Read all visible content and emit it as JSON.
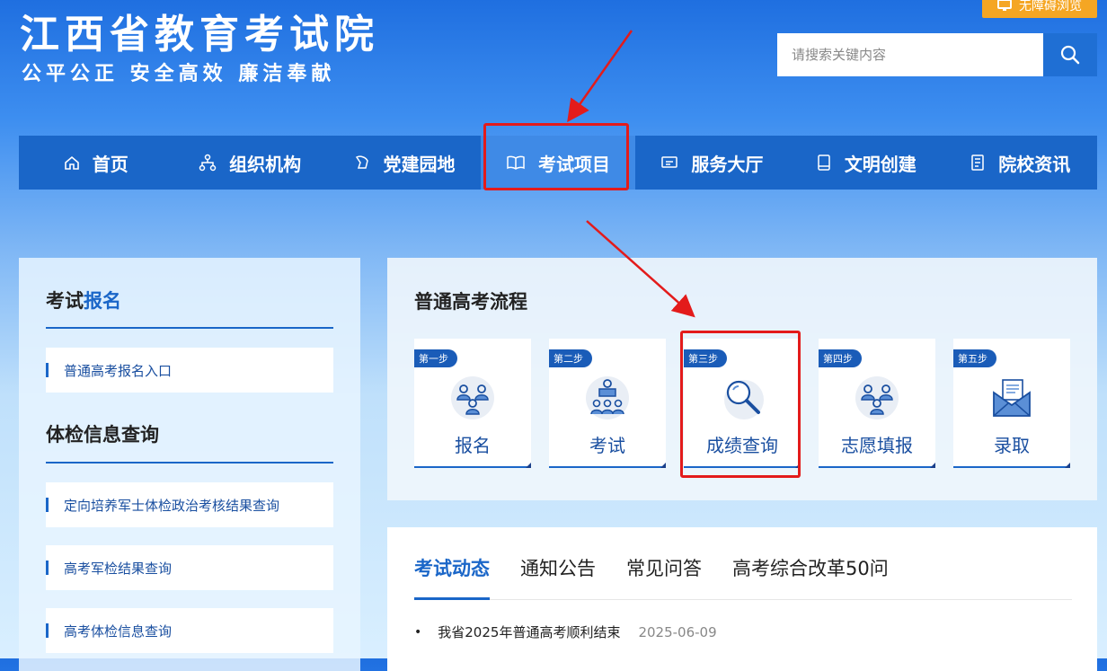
{
  "header": {
    "title": "江西省教育考试院",
    "slogan": "公平公正  安全高效  廉洁奉献",
    "accessibility_label": "无障碍浏览",
    "search": {
      "placeholder": "请搜索关键内容",
      "value": ""
    }
  },
  "nav": {
    "items": [
      {
        "label": "首页",
        "icon": "home-icon"
      },
      {
        "label": "组织机构",
        "icon": "org-chart-icon"
      },
      {
        "label": "党建园地",
        "icon": "party-icon"
      },
      {
        "label": "考试项目",
        "icon": "book-icon",
        "active": true
      },
      {
        "label": "服务大厅",
        "icon": "service-icon"
      },
      {
        "label": "文明创建",
        "icon": "notebook-icon"
      },
      {
        "label": "院校资讯",
        "icon": "document-icon"
      }
    ]
  },
  "left_panel": {
    "section1": {
      "title_prefix": "考试",
      "title_highlight": "报名",
      "links": [
        "普通高考报名入口"
      ]
    },
    "section2": {
      "title": "体检信息查询",
      "links": [
        "定向培养军士体检政治考核结果查询",
        "高考军检结果查询",
        "高考体检信息查询"
      ]
    }
  },
  "process": {
    "title": "普通高考流程",
    "steps": [
      {
        "badge": "第一步",
        "label": "报名",
        "icon": "people-icon"
      },
      {
        "badge": "第二步",
        "label": "考试",
        "icon": "exam-icon"
      },
      {
        "badge": "第三步",
        "label": "成绩查询",
        "icon": "magnifier-icon"
      },
      {
        "badge": "第四步",
        "label": "志愿填报",
        "icon": "people-icon"
      },
      {
        "badge": "第五步",
        "label": "录取",
        "icon": "envelope-icon"
      }
    ]
  },
  "news": {
    "tabs": [
      "考试动态",
      "通知公告",
      "常见问答",
      "高考综合改革50问"
    ],
    "items": [
      {
        "title": "我省2025年普通高考顺利结束",
        "date": "2025-06-09"
      }
    ]
  },
  "colors": {
    "primary": "#1a66c8",
    "accent": "#f5a623",
    "highlight": "#e31b1b"
  }
}
